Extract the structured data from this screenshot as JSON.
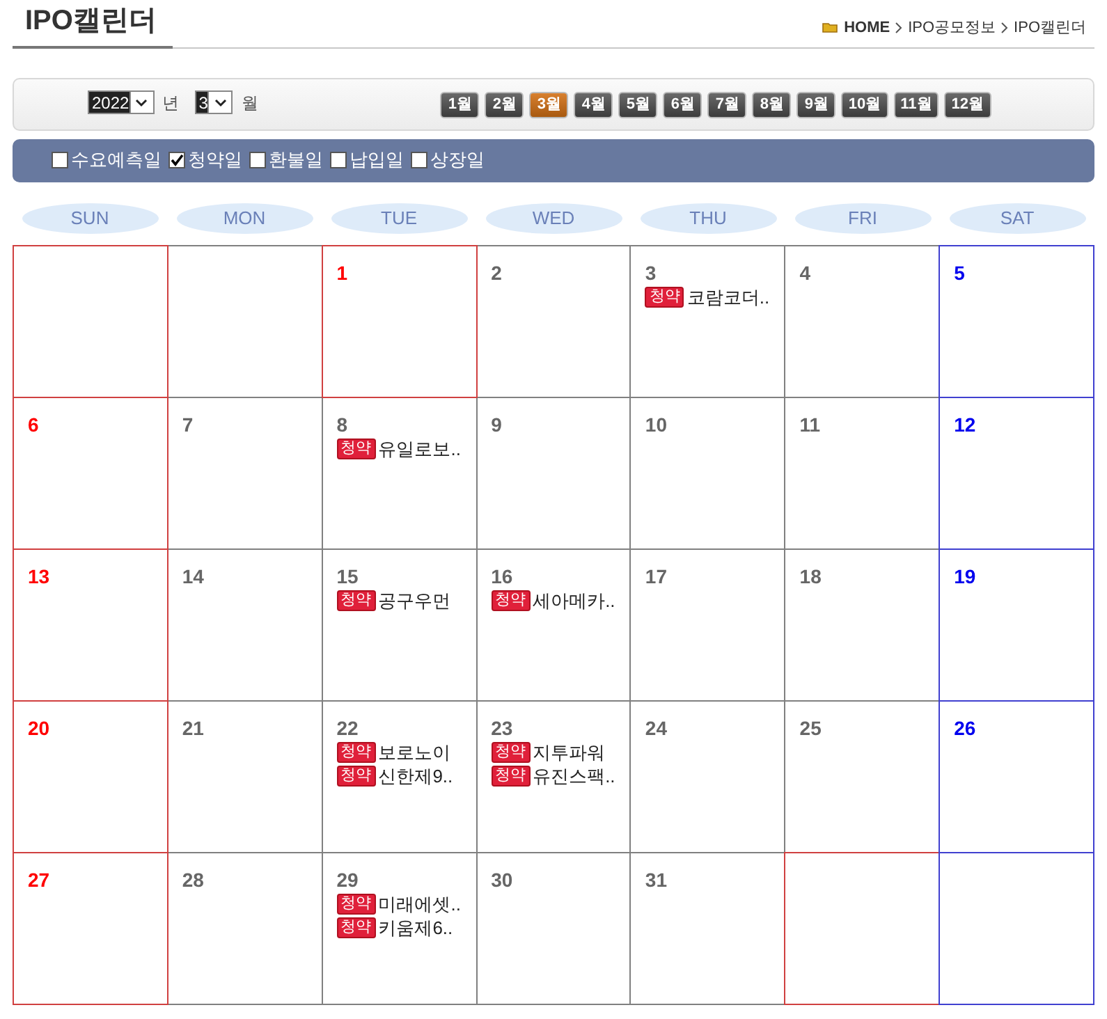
{
  "page_title": "IPO캘린더",
  "breadcrumb": [
    {
      "label": "HOME",
      "bold": true
    },
    {
      "label": "IPO공모정보",
      "bold": false
    },
    {
      "label": "IPO캘린더",
      "bold": false
    }
  ],
  "year_select": {
    "value": "2022",
    "unit": "년"
  },
  "month_select": {
    "value": "3",
    "unit": "월"
  },
  "month_buttons": [
    {
      "label": "1월",
      "selected": false
    },
    {
      "label": "2월",
      "selected": false
    },
    {
      "label": "3월",
      "selected": true
    },
    {
      "label": "4월",
      "selected": false
    },
    {
      "label": "5월",
      "selected": false
    },
    {
      "label": "6월",
      "selected": false
    },
    {
      "label": "7월",
      "selected": false
    },
    {
      "label": "8월",
      "selected": false
    },
    {
      "label": "9월",
      "selected": false
    },
    {
      "label": "10월",
      "selected": false
    },
    {
      "label": "11월",
      "selected": false
    },
    {
      "label": "12월",
      "selected": false
    }
  ],
  "filters": [
    {
      "label": "수요예측일",
      "checked": false
    },
    {
      "label": "청약일",
      "checked": true
    },
    {
      "label": "환불일",
      "checked": false
    },
    {
      "label": "납입일",
      "checked": false
    },
    {
      "label": "상장일",
      "checked": false
    }
  ],
  "weekdays": [
    "SUN",
    "MON",
    "TUE",
    "WED",
    "THU",
    "FRI",
    "SAT"
  ],
  "weeks": [
    [
      {
        "kind": "sunday"
      },
      {
        "kind": "weekday"
      },
      {
        "day": "1",
        "kind": "holiday"
      },
      {
        "day": "2",
        "kind": "weekday"
      },
      {
        "day": "3",
        "kind": "weekday",
        "events": [
          {
            "badge": "청약",
            "name": "코람코더.."
          }
        ]
      },
      {
        "day": "4",
        "kind": "weekday"
      },
      {
        "day": "5",
        "kind": "saturday"
      }
    ],
    [
      {
        "day": "6",
        "kind": "sunday"
      },
      {
        "day": "7",
        "kind": "weekday"
      },
      {
        "day": "8",
        "kind": "weekday",
        "events": [
          {
            "badge": "청약",
            "name": "유일로보.."
          }
        ]
      },
      {
        "day": "9",
        "kind": "weekday"
      },
      {
        "day": "10",
        "kind": "weekday"
      },
      {
        "day": "11",
        "kind": "weekday"
      },
      {
        "day": "12",
        "kind": "saturday"
      }
    ],
    [
      {
        "day": "13",
        "kind": "sunday"
      },
      {
        "day": "14",
        "kind": "weekday"
      },
      {
        "day": "15",
        "kind": "weekday",
        "events": [
          {
            "badge": "청약",
            "name": "공구우먼"
          }
        ]
      },
      {
        "day": "16",
        "kind": "weekday",
        "events": [
          {
            "badge": "청약",
            "name": "세아메카.."
          }
        ]
      },
      {
        "day": "17",
        "kind": "weekday"
      },
      {
        "day": "18",
        "kind": "weekday"
      },
      {
        "day": "19",
        "kind": "saturday"
      }
    ],
    [
      {
        "day": "20",
        "kind": "sunday"
      },
      {
        "day": "21",
        "kind": "weekday"
      },
      {
        "day": "22",
        "kind": "weekday",
        "events": [
          {
            "badge": "청약",
            "name": "보로노이"
          },
          {
            "badge": "청약",
            "name": "신한제9.."
          }
        ]
      },
      {
        "day": "23",
        "kind": "weekday",
        "events": [
          {
            "badge": "청약",
            "name": "지투파워"
          },
          {
            "badge": "청약",
            "name": "유진스팩.."
          }
        ]
      },
      {
        "day": "24",
        "kind": "weekday"
      },
      {
        "day": "25",
        "kind": "weekday"
      },
      {
        "day": "26",
        "kind": "saturday"
      }
    ],
    [
      {
        "day": "27",
        "kind": "sunday"
      },
      {
        "day": "28",
        "kind": "weekday"
      },
      {
        "day": "29",
        "kind": "weekday",
        "events": [
          {
            "badge": "청약",
            "name": "미래에셋.."
          },
          {
            "badge": "청약",
            "name": "키움제6.."
          }
        ]
      },
      {
        "day": "30",
        "kind": "weekday"
      },
      {
        "day": "31",
        "kind": "weekday"
      },
      {
        "kind": "holiday"
      },
      {
        "kind": "saturday"
      }
    ]
  ]
}
